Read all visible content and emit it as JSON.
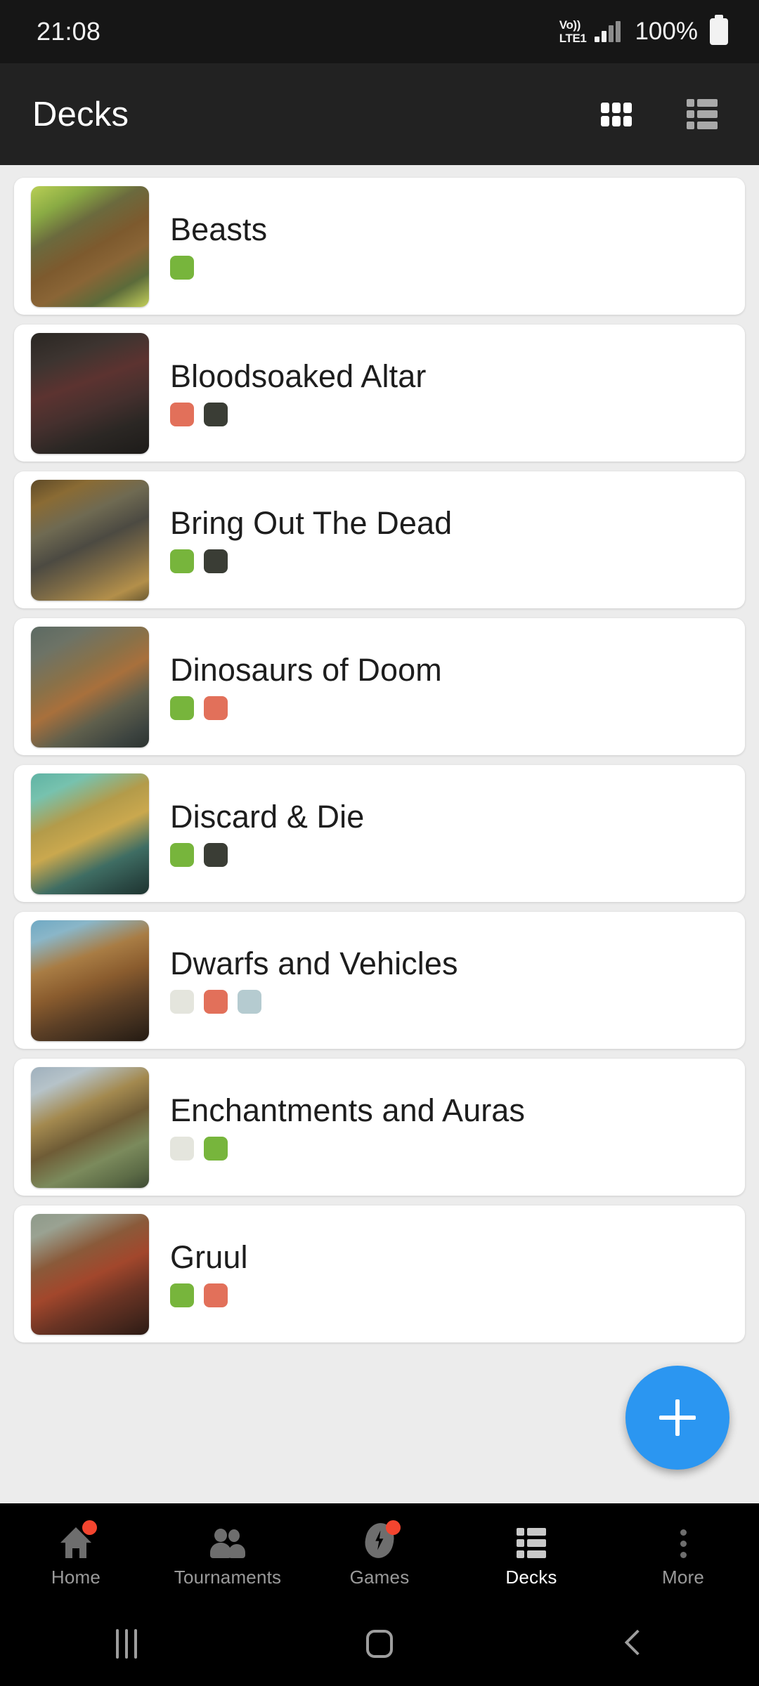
{
  "status_bar": {
    "time": "21:08",
    "network_line1": "Vo))",
    "network_line2": "LTE1",
    "battery_percent": "100%"
  },
  "app_bar": {
    "title": "Decks",
    "grid_view_label": "grid-view",
    "list_view_label": "list-view"
  },
  "colors": {
    "accent": "#2b96f1",
    "appbar_bg": "#222222",
    "statusbar_bg": "#161616",
    "page_bg": "#ececec",
    "card_bg": "#ffffff",
    "badge": "#f4452f",
    "mana_green": "#77b53c",
    "mana_red": "#e2705a",
    "mana_black": "#3a3d35",
    "mana_white": "#e4e5dd",
    "mana_blue": "#b5cbd0"
  },
  "decks": [
    {
      "name": "Beasts",
      "colors": [
        "#77b53c"
      ],
      "thumb": "beasts-artwork",
      "thumb_css": "linear-gradient(150deg,#b9cf55 0%,#8aab44 18%,#6b6a3e 34%,#7d5a2e 52%,#8a6536 66%,#5c6b3a 82%,#c3cf5a 100%)"
    },
    {
      "name": "Bloodsoaked Altar",
      "colors": [
        "#e2705a",
        "#3a3d35"
      ],
      "thumb": "bloodsoaked-altar-artwork",
      "thumb_css": "linear-gradient(160deg,#2a2723 0%,#3d3430 22%,#5c3330 42%,#46302e 60%,#2b2724 78%,#1d1b19 100%)"
    },
    {
      "name": "Bring Out The Dead",
      "colors": [
        "#77b53c",
        "#3a3d35"
      ],
      "thumb": "bring-out-the-dead-artwork",
      "thumb_css": "linear-gradient(155deg,#5e4a28 0%,#8a6b34 16%,#6f6a52 34%,#4c4a42 52%,#7c6a46 70%,#b38f4a 88%,#6a5932 100%)"
    },
    {
      "name": "Dinosaurs of Doom",
      "colors": [
        "#77b53c",
        "#e2705a"
      ],
      "thumb": "dinosaurs-of-doom-artwork",
      "thumb_css": "linear-gradient(150deg,#5c6a63 0%,#6d7366 18%,#8a7148 38%,#a8703c 52%,#5f5f4c 70%,#3d4440 88%,#2c3330 100%)"
    },
    {
      "name": "Discard & Die",
      "colors": [
        "#77b53c",
        "#3a3d35"
      ],
      "thumb": "discard-and-die-artwork",
      "thumb_css": "linear-gradient(155deg,#5fb3a4 0%,#77c2ae 16%,#b39b4a 36%,#caa84e 52%,#3f6d63 72%,#2b4a45 88%,#1e3430 100%)"
    },
    {
      "name": "Dwarfs and Vehicles",
      "colors": [
        "#e4e5dd",
        "#e2705a",
        "#b5cbd0"
      ],
      "thumb": "dwarfs-and-vehicles-artwork",
      "thumb_css": "linear-gradient(160deg,#6fa9c4 0%,#8ab6c8 14%,#a87c44 34%,#8a5c2e 52%,#5d4026 70%,#3a2a1c 88%,#241a12 100%)"
    },
    {
      "name": "Enchantments and Auras",
      "colors": [
        "#e4e5dd",
        "#77b53c"
      ],
      "thumb": "enchantments-and-auras-artwork",
      "thumb_css": "linear-gradient(155deg,#9fb0bd 0%,#b6c3c9 16%,#a3894f 36%,#6f5c36 54%,#7b8a5c 72%,#5c6b46 88%,#3e4a34 100%)"
    },
    {
      "name": "Gruul",
      "colors": [
        "#77b53c",
        "#e2705a"
      ],
      "thumb": "gruul-artwork",
      "thumb_css": "linear-gradient(155deg,#8e9a8a 0%,#9aa292 14%,#8a5a3a 34%,#a2472c 52%,#6b3424 70%,#45261c 88%,#2c1a14 100%)"
    }
  ],
  "fab": {
    "label": "+",
    "name": "add-deck"
  },
  "bottom_nav": [
    {
      "label": "Home",
      "icon": "home-icon",
      "badge": true,
      "active": false
    },
    {
      "label": "Tournaments",
      "icon": "people-icon",
      "badge": false,
      "active": false
    },
    {
      "label": "Games",
      "icon": "lightning-icon",
      "badge": true,
      "active": false
    },
    {
      "label": "Decks",
      "icon": "list-icon",
      "badge": false,
      "active": true
    },
    {
      "label": "More",
      "icon": "more-vert-icon",
      "badge": false,
      "active": false
    }
  ],
  "system_nav": {
    "recents": "recents-button",
    "home": "home-button",
    "back": "back-button"
  }
}
